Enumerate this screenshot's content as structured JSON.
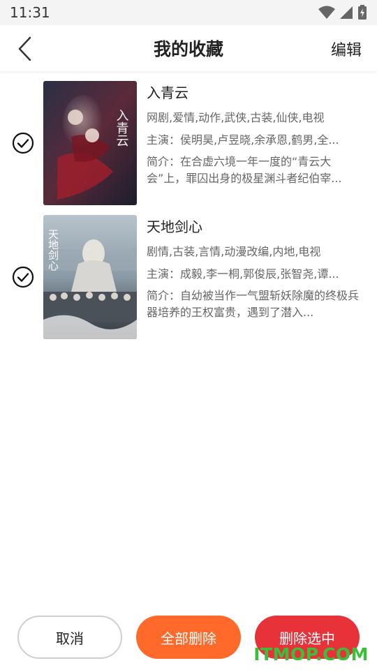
{
  "status": {
    "time": "11:31"
  },
  "header": {
    "title": "我的收藏",
    "edit_label": "编辑"
  },
  "items": [
    {
      "title": "入青云",
      "tags": "网剧,爱情,动作,武侠,古装,仙侠,电视",
      "cast": "主演：侯明昊,卢昱晓,余承恩,鹤男,全...",
      "desc": "简介：在合虚六境一年一度的“青云大会”上，罪囚出身的极星渊斗者纪伯宰...",
      "poster_text": "入青云",
      "checked": true
    },
    {
      "title": "天地剑心",
      "tags": "剧情,古装,言情,动漫改编,内地,电视",
      "cast": "主演：成毅,李一桐,郭俊辰,张智尧,谭...",
      "desc": "简介：自幼被当作一气盟斩妖除魔的终极兵器培养的王权富贵，遇到了潜入...",
      "poster_text": "天地剑心",
      "checked": true
    }
  ],
  "footer": {
    "cancel_label": "取消",
    "delete_all_label": "全部删除",
    "delete_selected_label": "删除选中"
  },
  "watermark": "ITMOP.COM",
  "colors": {
    "delete_all": "#ff6a2b",
    "delete_selected": "#e8323a",
    "watermark": "#3bbf3b"
  }
}
